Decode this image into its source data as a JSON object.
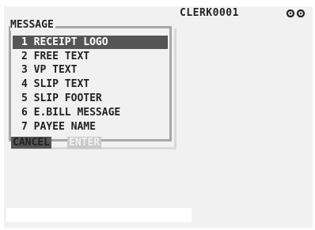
{
  "header": {
    "clerk": "CLERK0001",
    "status_icon": "link-status-icon"
  },
  "menu": {
    "title": "MESSAGE",
    "items": [
      {
        "label": "1 RECEIPT LOGO",
        "selected": true
      },
      {
        "label": "2 FREE TEXT"
      },
      {
        "label": "3 VP TEXT"
      },
      {
        "label": "4 SLIP TEXT"
      },
      {
        "label": "5 SLIP FOOTER"
      },
      {
        "label": "6 E.BILL MESSAGE"
      },
      {
        "label": "7 PAYEE NAME"
      }
    ]
  },
  "buttons": {
    "cancel": "CANCEL",
    "enter": "ENTER"
  },
  "colors": {
    "selected_bg": "#555555",
    "frame": "#a7a7a7",
    "screen_bg": "#f1f1f1"
  }
}
